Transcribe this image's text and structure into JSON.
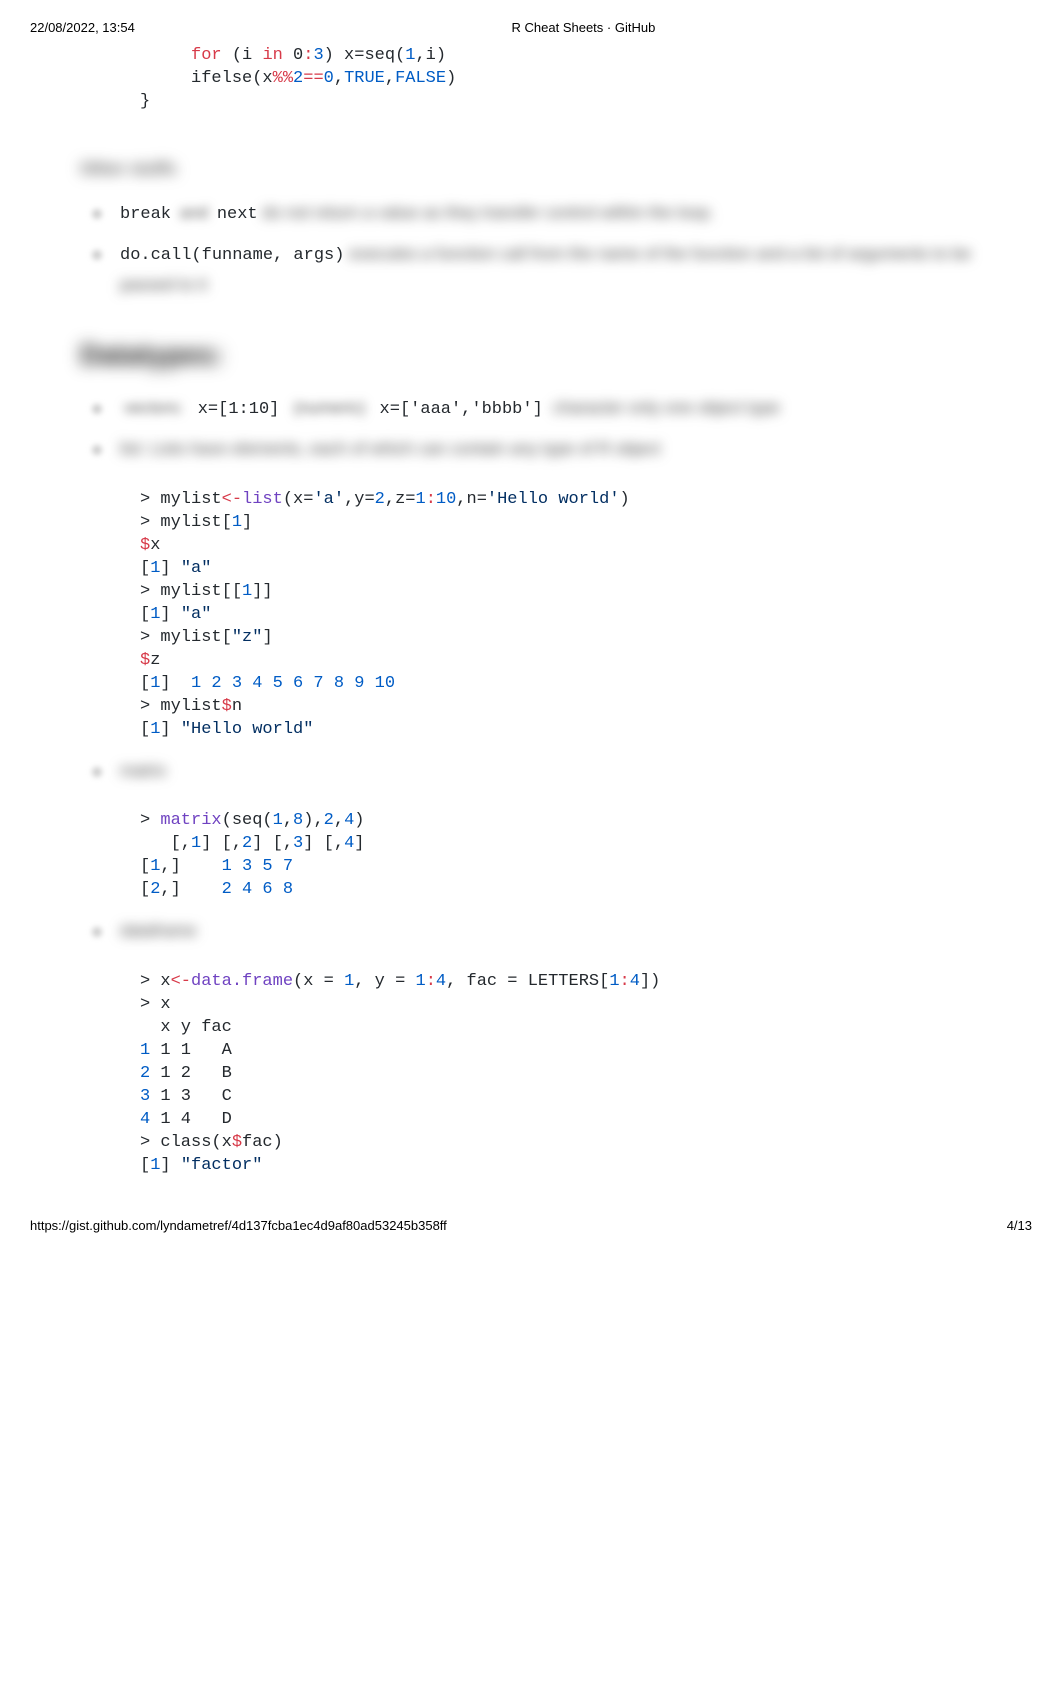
{
  "header": {
    "timestamp": "22/08/2022, 13:54",
    "title": "R Cheat Sheets · GitHub"
  },
  "code1": {
    "line1_for": "for",
    "line1_paren1": " (i ",
    "line1_in": "in",
    "line1_range": " 0",
    "line1_colon": ":",
    "line1_three": "3",
    "line1_paren2": ") x=seq(",
    "line1_one": "1",
    "line1_comma_i": ",i)",
    "line2_ifelse": "ifelse(x",
    "line2_mod": "%%",
    "line2_two": "2",
    "line2_eq": "==",
    "line2_zero": "0",
    "line2_comma": ",",
    "line2_true": "TRUE",
    "line2_comma2": ",",
    "line2_false": "FALSE",
    "line2_close": ")",
    "line3": "}"
  },
  "section_other": "Other stuffs",
  "bullets1": {
    "b1_break": "break",
    "b1_and": " and ",
    "b1_next": "next",
    "b1_rest": " do not return a value as they transfer control within the loop.",
    "b2_docall": "do.call(funname, args)",
    "b2_rest": " executes a function call from the name of the function and a list of arguments to be passed to it"
  },
  "section_datatypes": "Datatypes:",
  "bullets2": {
    "b1_vectors": "vectors:",
    "b1_code1": " x=[1:10] ",
    "b1_numeric": "(numeric)",
    "b1_code2": " x=['aaa','bbbb'] ",
    "b1_char": "character only one object type",
    "b2_text": "list: Lists have elements, each of which can contain any type of R object"
  },
  "listcode": {
    "l1": "> mylist",
    "l1_assign": "<-",
    "l1_list": "list",
    "l1_args1": "(x=",
    "l1_a": "'a'",
    "l1_y": ",y=",
    "l1_two": "2",
    "l1_z": ",z=",
    "l1_one": "1",
    "l1_colon": ":",
    "l1_ten": "10",
    "l1_n": ",n=",
    "l1_hello": "'Hello world'",
    "l1_close": ")",
    "l2": "> mylist[",
    "l2_one": "1",
    "l2_close": "]",
    "l3_dollar": "$",
    "l3_x": "x",
    "l4_br": "[",
    "l4_one": "1",
    "l4_close": "] ",
    "l4_a": "\"a\"",
    "l5": "> mylist[[",
    "l5_one": "1",
    "l5_close": "]]",
    "l6_br": "[",
    "l6_one": "1",
    "l6_close": "] ",
    "l6_a": "\"a\"",
    "l7": "> mylist[",
    "l7_z": "\"z\"",
    "l7_close": "]",
    "l8_dollar": "$",
    "l8_z": "z",
    "l9_br": "[",
    "l9_one": "1",
    "l9_close": "]  ",
    "l9_nums": "1 2 3 4 5 6 7 8 9 10",
    "l10": "> mylist",
    "l10_dollar": "$",
    "l10_n": "n",
    "l11_br": "[",
    "l11_one": "1",
    "l11_close": "] ",
    "l11_hello": "\"Hello world\""
  },
  "section_matrix": "matrix",
  "matrixcode": {
    "l1_prompt": "> ",
    "l1_matrix": "matrix",
    "l1_open": "(seq(",
    "l1_one": "1",
    "l1_c1": ",",
    "l1_eight": "8",
    "l1_close1": "),",
    "l1_two": "2",
    "l1_c2": ",",
    "l1_four": "4",
    "l1_close2": ")",
    "l2": "   [,",
    "l2_1": "1",
    "l2_b": "] [,",
    "l2_2": "2",
    "l2_c": "] [,",
    "l2_3": "3",
    "l2_d": "] [,",
    "l2_4": "4",
    "l2_e": "]",
    "l3_a": "[",
    "l3_1": "1",
    "l3_b": ",]    ",
    "l3_vals": "1 3 5 7",
    "l4_a": "[",
    "l4_2": "2",
    "l4_b": ",]    ",
    "l4_vals": "2 4 6 8"
  },
  "section_dataframe": "dataframe",
  "dfcode": {
    "l1_prompt": "> x",
    "l1_assign": "<-",
    "l1_df": "data.frame",
    "l1_open": "(x = ",
    "l1_one": "1",
    "l1_y": ", y = ",
    "l1_1b": "1",
    "l1_colon": ":",
    "l1_four": "4",
    "l1_fac": ", fac = LETTERS[",
    "l1_1c": "1",
    "l1_colon2": ":",
    "l1_4b": "4",
    "l1_close": "])",
    "l2": "> x",
    "l3": "  x y fac",
    "l4_1": "1",
    "l4_rest": " 1 1   A",
    "l5_2": "2",
    "l5_rest": " 1 2   B",
    "l6_3": "3",
    "l6_rest": " 1 3   C",
    "l7_4": "4",
    "l7_rest": " 1 4   D",
    "l8": "> class(x",
    "l8_dollar": "$",
    "l8_fac": "fac)",
    "l9_br": "[",
    "l9_one": "1",
    "l9_close": "] ",
    "l9_factor": "\"factor\""
  },
  "footer": {
    "url": "https://gist.github.com/lyndametref/4d137fcba1ec4d9af80ad53245b358ff",
    "page": "4/13"
  }
}
